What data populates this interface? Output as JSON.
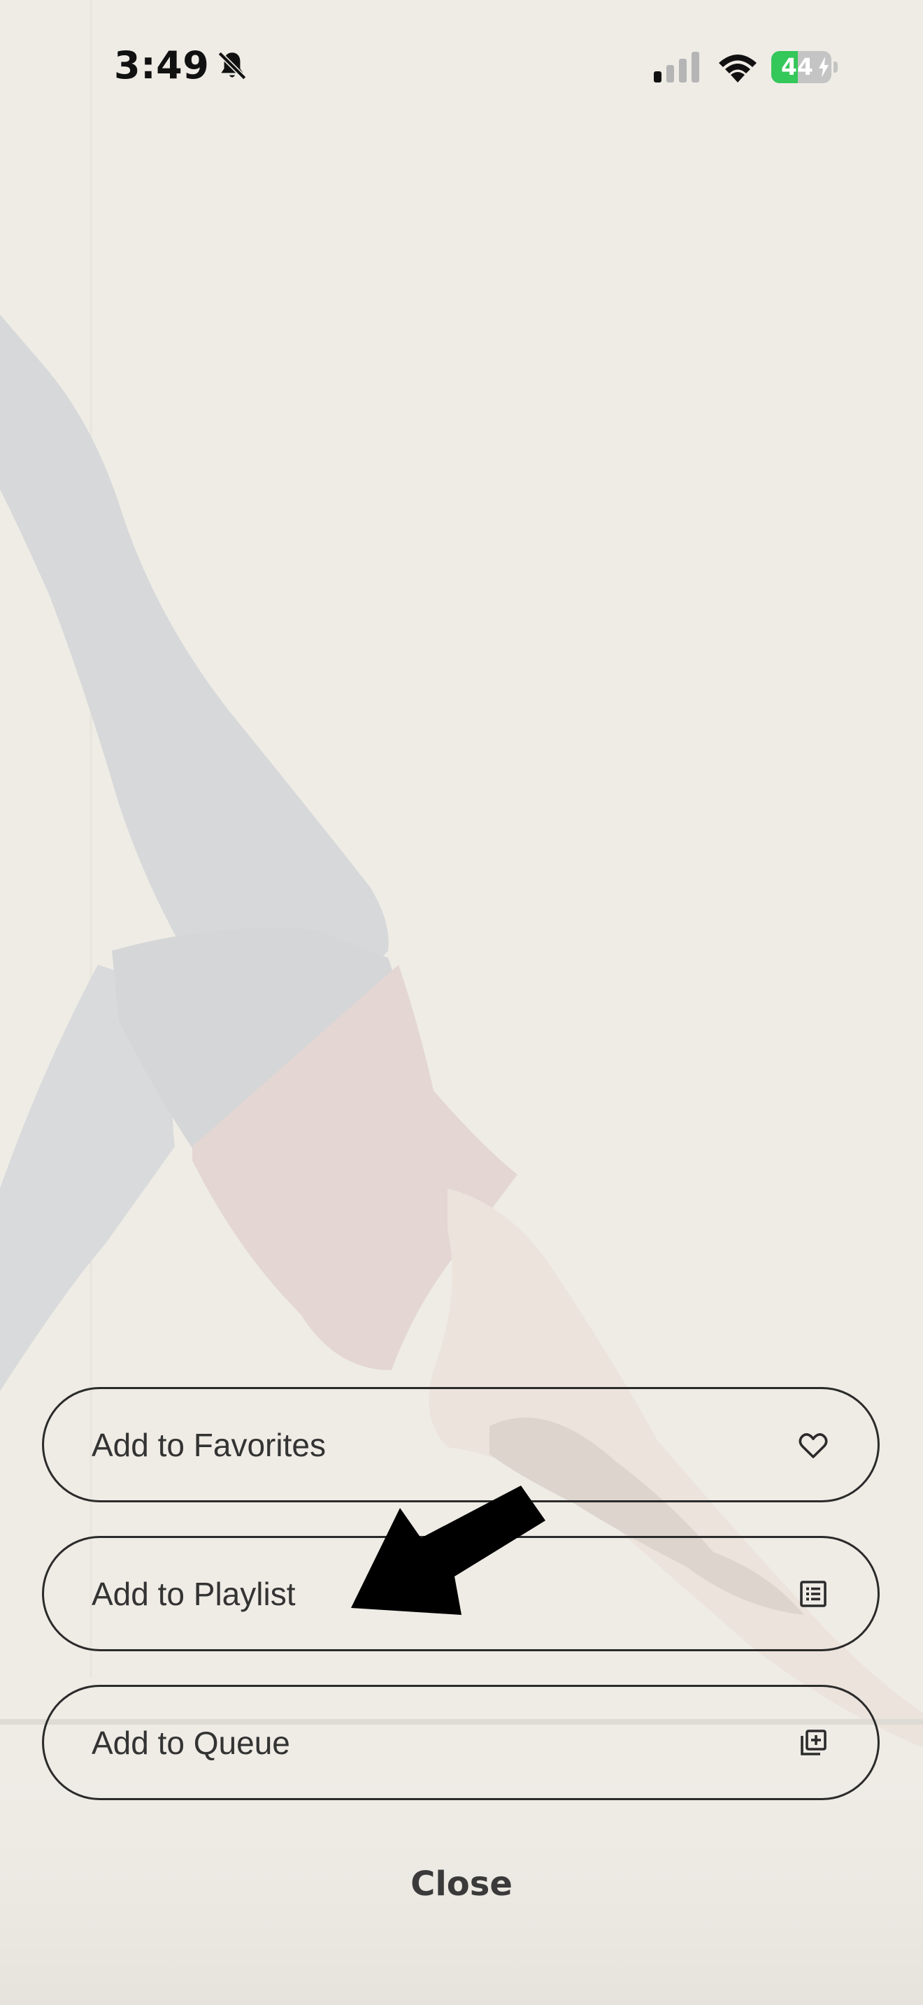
{
  "status_bar": {
    "time": "3:49",
    "battery_level": "44",
    "battery_fraction": 0.44,
    "cellular_bars": 1,
    "icons": [
      "bell-slash-icon",
      "cellular-signal-icon",
      "wifi-icon",
      "battery-charging-icon"
    ],
    "battery_color": "#34c759"
  },
  "background": {
    "description_icon": "yoga-photo"
  },
  "actions": [
    {
      "label": "Add to Favorites",
      "icon": "heart-icon"
    },
    {
      "label": "Add to Playlist",
      "icon": "list-icon"
    },
    {
      "label": "Add to Queue",
      "icon": "add-to-queue-icon"
    }
  ],
  "close_label": "Close",
  "colors": {
    "background": "#efece6",
    "button_border": "#2b2b2b",
    "text": "#333333"
  }
}
